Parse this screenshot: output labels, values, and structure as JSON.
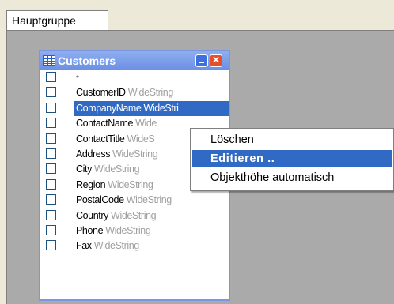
{
  "tabs": [
    {
      "label": "Hauptgruppe"
    }
  ],
  "table_panel": {
    "title": "Customers",
    "fields": [
      {
        "name": "*",
        "type": ""
      },
      {
        "name": "CustomerID",
        "type": "WideString"
      },
      {
        "name": "CompanyName",
        "type": "WideStri"
      },
      {
        "name": "ContactName",
        "type": "Wide"
      },
      {
        "name": "ContactTitle",
        "type": "WideS"
      },
      {
        "name": "Address",
        "type": "WideString"
      },
      {
        "name": "City",
        "type": "WideString"
      },
      {
        "name": "Region",
        "type": "WideString"
      },
      {
        "name": "PostalCode",
        "type": "WideString"
      },
      {
        "name": "Country",
        "type": "WideString"
      },
      {
        "name": "Phone",
        "type": "WideString"
      },
      {
        "name": "Fax",
        "type": "WideString"
      }
    ],
    "selected_index": 2
  },
  "context_menu": {
    "items": [
      {
        "label": "Löschen"
      },
      {
        "label": "Editieren .."
      },
      {
        "label": "Objekthöhe automatisch"
      }
    ],
    "active_index": 1
  },
  "colors": {
    "selection": "#316ac5",
    "canvas": "#abaaab",
    "titlebar": "#6b8fe3"
  }
}
